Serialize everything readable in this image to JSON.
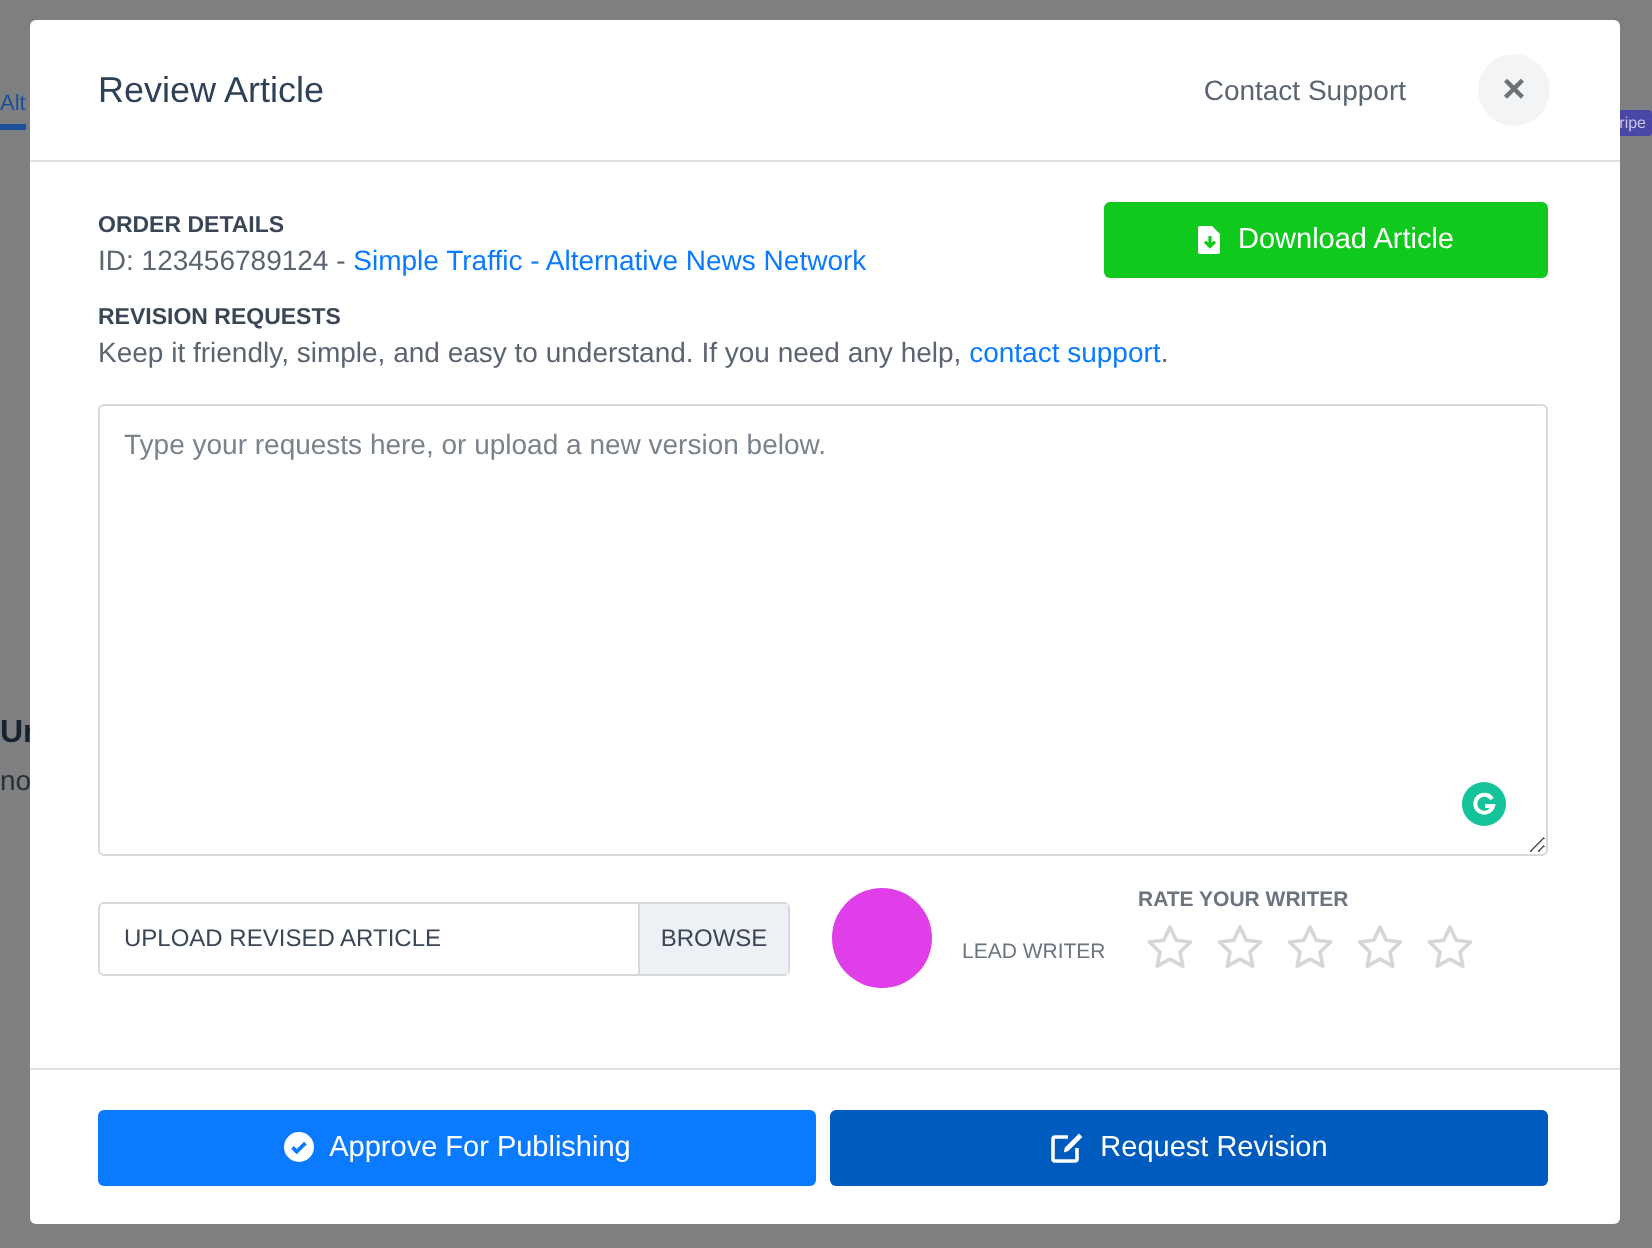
{
  "background": {
    "fragments": [
      {
        "kind": "tab",
        "text": "Alt"
      },
      {
        "kind": "heading",
        "text": "Ur"
      },
      {
        "kind": "text",
        "text": "no"
      },
      {
        "kind": "badge",
        "text": "ripe"
      }
    ]
  },
  "modal": {
    "title": "Review Article",
    "contact_link": "Contact Support",
    "close": "×"
  },
  "order": {
    "label": "ORDER DETAILS",
    "id_text": "ID: 123456789124 - ",
    "link": "Simple Traffic - Alternative News Network",
    "download_button": "Download Article"
  },
  "revision": {
    "label": "REVISION REQUESTS",
    "hint": "Keep it friendly, simple, and easy to understand. If you need any help, ",
    "hint_link": "contact support",
    "hint_end": ".",
    "placeholder": "Type your requests here, or upload a new version below."
  },
  "upload": {
    "label": "UPLOAD REVISED ARTICLE",
    "button": "BROWSE"
  },
  "writer": {
    "role": "LEAD WRITER"
  },
  "rating": {
    "label": "RATE YOUR WRITER",
    "stars": 0
  },
  "footer": {
    "approve_button": "Approve For Publishing",
    "revision_button": "Request Revision"
  }
}
